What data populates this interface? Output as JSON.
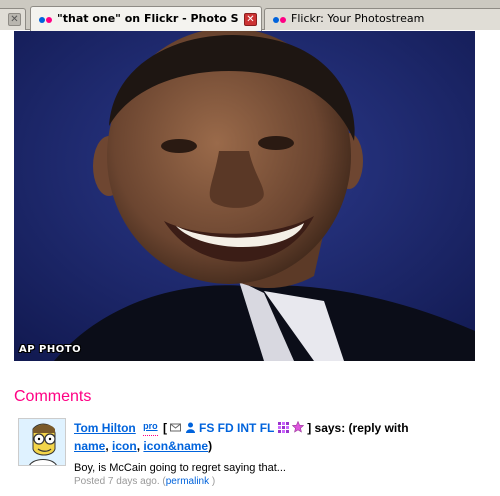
{
  "tabs": [
    {
      "label": "",
      "active": false
    },
    {
      "label": "\"that one\" on Flickr - Photo Shari...",
      "active": true
    },
    {
      "label": "Flickr: Your Photostream",
      "active": false
    }
  ],
  "tab_close_glyph": "✕",
  "photo": {
    "credit": "AP PHOTO",
    "icon": "portrait-photo"
  },
  "comments": {
    "heading": "Comments",
    "items": [
      {
        "author": "Tom Hilton",
        "badge": "pro",
        "open_bracket": "[",
        "fs": "FS",
        "fd": "FD",
        "int": "INT",
        "fl": "FL",
        "close_bracket": "]",
        "says": "says: (reply with",
        "reply_name": "name",
        "reply_icon": "icon",
        "reply_both": "icon&name",
        "close_paren": ")",
        "body": "Boy, is McCain going to regret saying that...",
        "posted": "Posted 7 days ago.",
        "permalink_open": "(",
        "permalink": "permalink",
        "permalink_close": ")"
      }
    ]
  },
  "colors": {
    "flickr_pink": "#ff0084",
    "flickr_blue": "#0063dc",
    "photo_background": "#1a2260"
  }
}
